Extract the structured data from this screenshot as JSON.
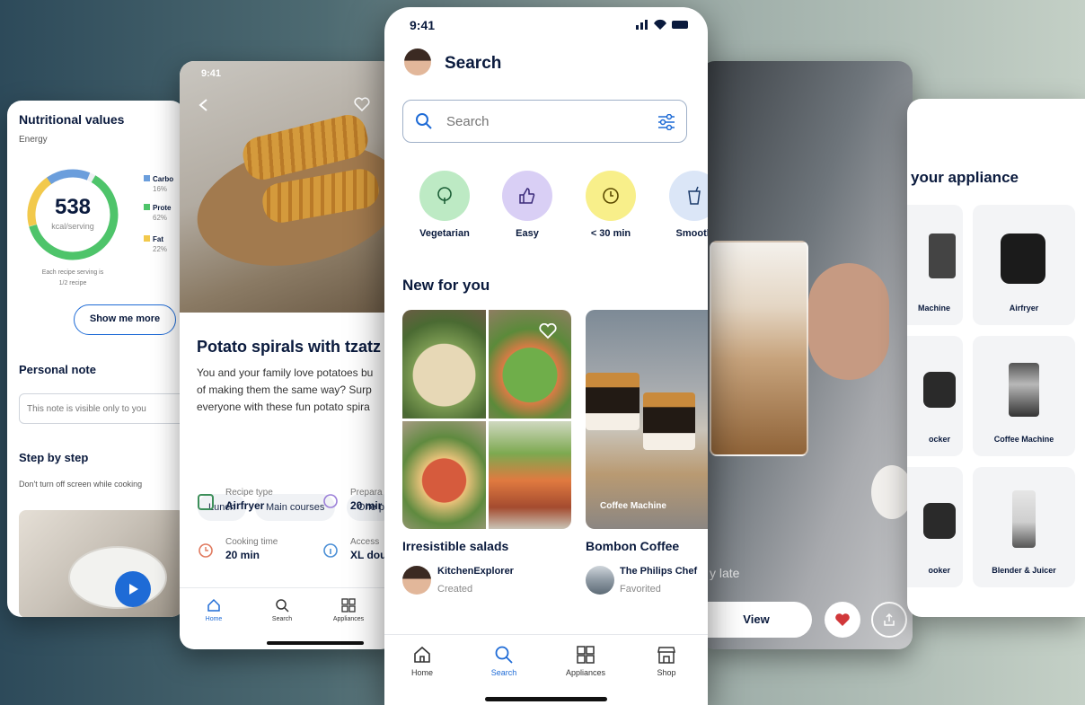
{
  "colors": {
    "accent": "#1e6bd6",
    "green": "#4ec46a",
    "dark_text": "#0a1a3d"
  },
  "nutrition_screen": {
    "title": "Nutritional values",
    "subtitle": "Energy",
    "calories": "538",
    "calories_unit": "kcal/serving",
    "legend": [
      {
        "name": "Carbo",
        "pct": "16%",
        "color": "#6b9edc"
      },
      {
        "name": "Prote",
        "pct": "62%",
        "color": "#4ec46a"
      },
      {
        "name": "Fat",
        "pct": "22%",
        "color": "#f2c94c"
      }
    ],
    "serving_note_1": "Each recipe serving is",
    "serving_note_2": "1/2 recipe",
    "show_more": "Show me more",
    "personal_note_title": "Personal note",
    "note_placeholder": "This note is visible only to you",
    "step_title": "Step by step",
    "step_note": "Don't turn off screen while cooking"
  },
  "recipe_screen": {
    "time": "9:41",
    "title": "Potato spirals with tzatz",
    "desc_1": "You and your family love potatoes bu",
    "desc_2": "of making them the same way? Surp",
    "desc_3": "everyone with these fun potato spira",
    "tags": [
      "Lunch",
      "Main courses",
      "One p"
    ],
    "meta": [
      {
        "k": "Recipe type",
        "v": "Airfryer"
      },
      {
        "k": "Prepara",
        "v": "20 mir"
      },
      {
        "k": "Cooking time",
        "v": "20 min"
      },
      {
        "k": "Access",
        "v": "XL dou"
      }
    ],
    "nav": [
      "Home",
      "Search",
      "Appliances"
    ]
  },
  "search_screen": {
    "time": "9:41",
    "title": "Search",
    "search_placeholder": "Search",
    "categories": [
      "Vegetarian",
      "Easy",
      "< 30 min",
      "Smooth"
    ],
    "section_title": "New for you",
    "cards": [
      {
        "title": "Irresistible salads",
        "author": "KitchenExplorer",
        "status": "Created"
      },
      {
        "title": "Bombon Coffee",
        "author": "The Philips Chef",
        "status": "Favorited",
        "overlay": "Coffee Machine"
      }
    ],
    "nav": [
      "Home",
      "Search",
      "Appliances",
      "Shop"
    ]
  },
  "coffee_screen": {
    "caption": "y late",
    "view_button": "View"
  },
  "appliance_screen": {
    "title": "your appliance",
    "tiles": [
      "Machine",
      "Airfryer",
      "ocker",
      "Coffee Machine",
      "ooker",
      "Blender & Juicer"
    ]
  }
}
